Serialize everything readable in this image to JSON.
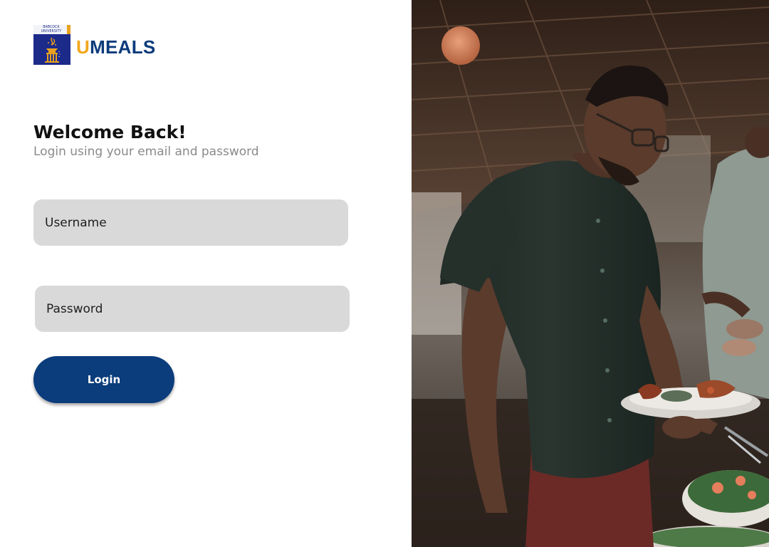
{
  "brand": {
    "logo_lines": [
      "BABCOCK",
      "UNIVERSITY"
    ],
    "name_initial": "U",
    "name_rest": "MEALS",
    "colors": {
      "primary": "#0b3c7c",
      "accent": "#f2a81d",
      "badge": "#1c2a8a"
    }
  },
  "login": {
    "title": "Welcome Back!",
    "subtitle": "Login using your email and password",
    "username_placeholder": "Username",
    "username_value": "",
    "password_placeholder": "Password",
    "password_value": "",
    "submit_label": "Login"
  },
  "hero_image": {
    "icon": "dining-photo"
  }
}
